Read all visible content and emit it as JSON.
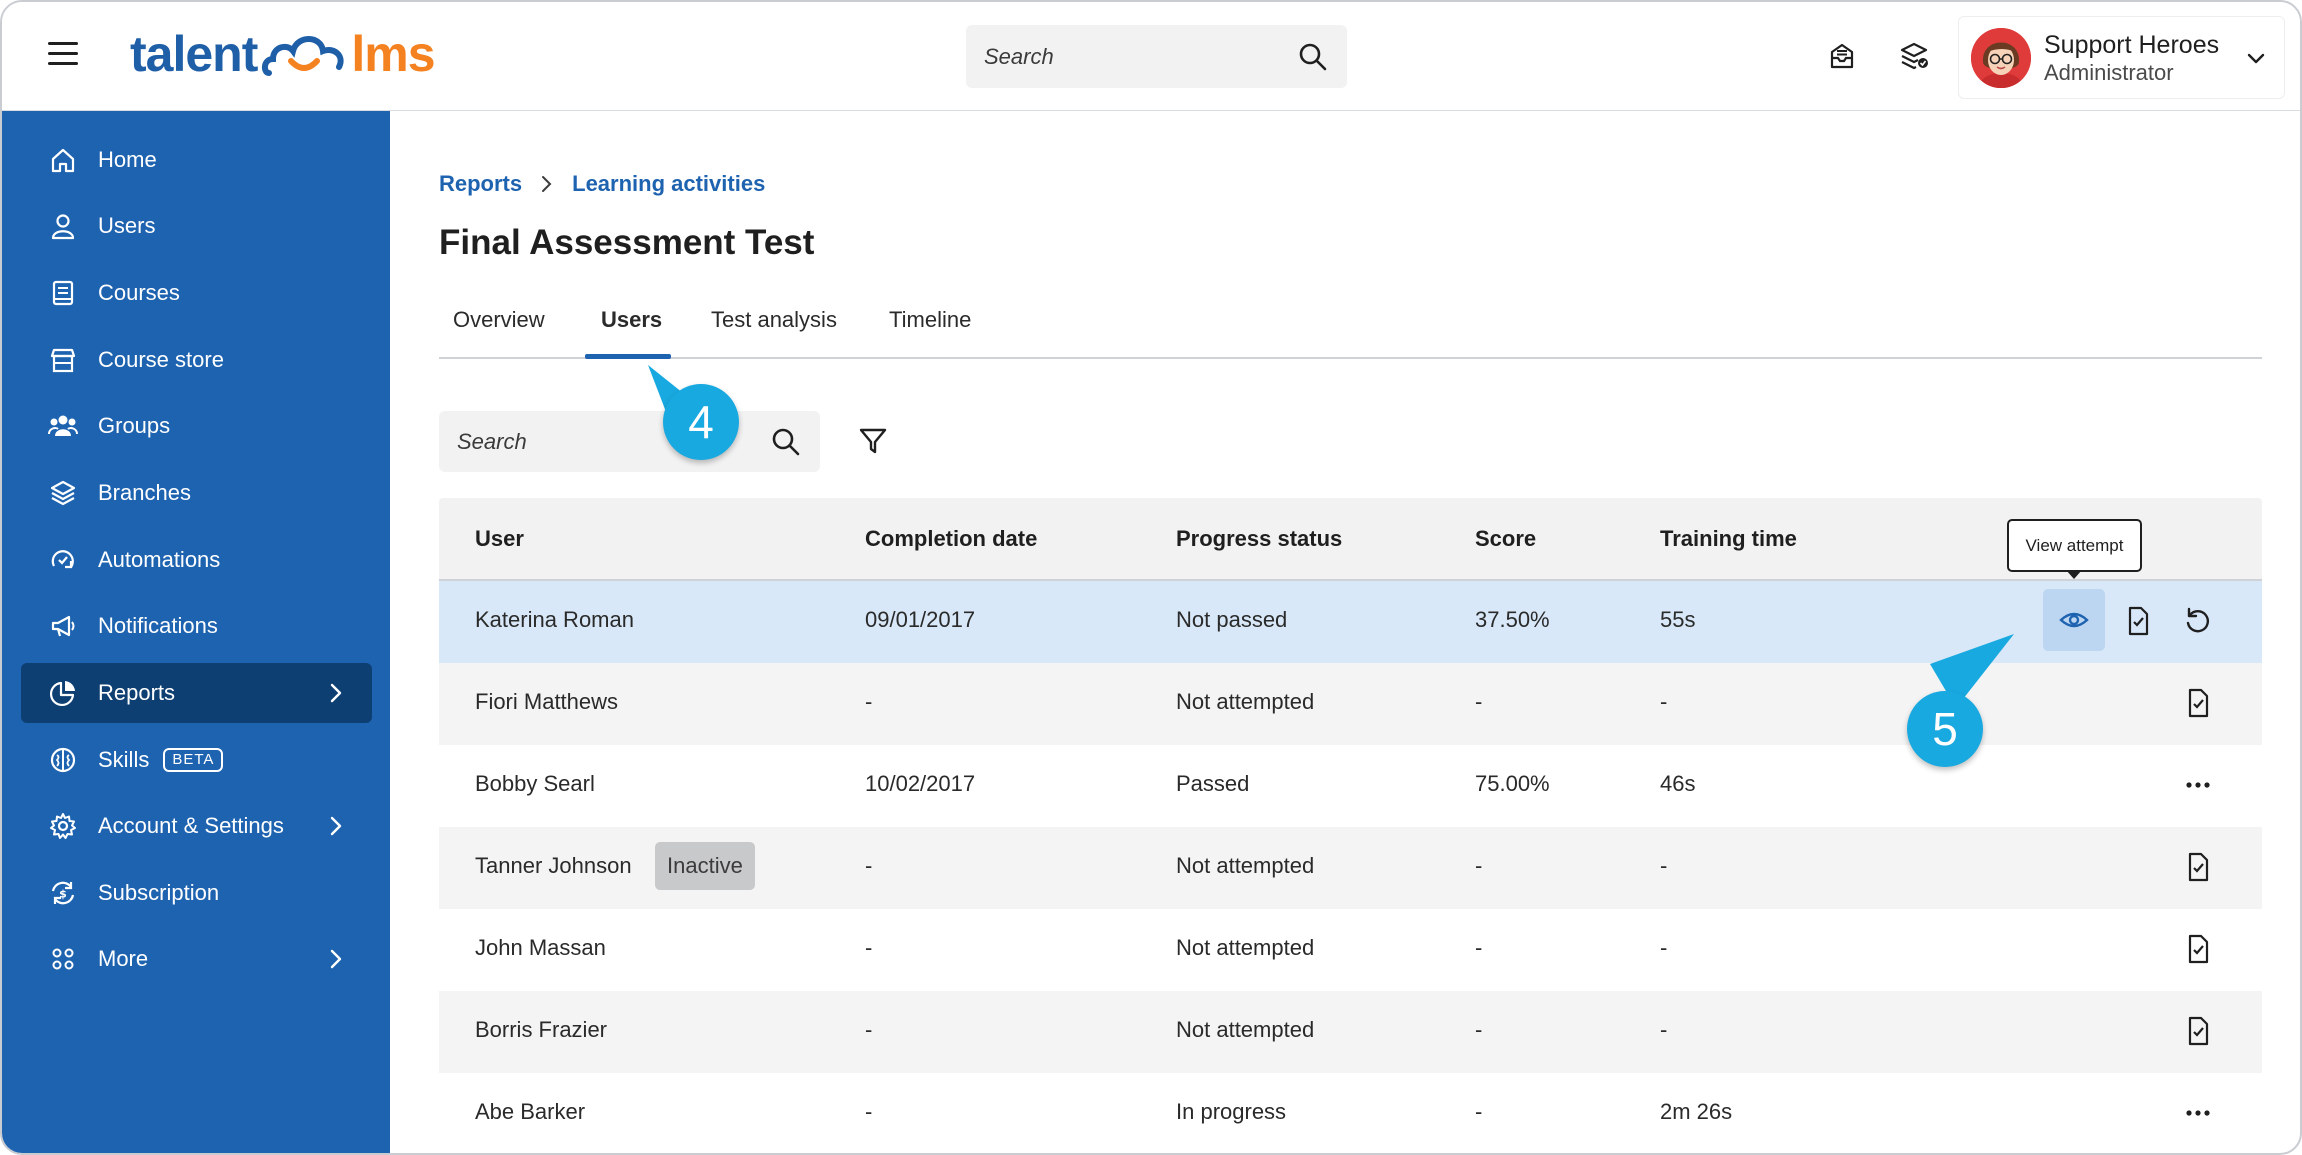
{
  "header": {
    "logo_left": "talent",
    "logo_right": "lms",
    "search_placeholder": "Search",
    "user_name": "Support Heroes",
    "user_role": "Administrator"
  },
  "sidebar": {
    "items": [
      {
        "label": "Home",
        "icon": "home-icon"
      },
      {
        "label": "Users",
        "icon": "user-icon"
      },
      {
        "label": "Courses",
        "icon": "book-icon"
      },
      {
        "label": "Course store",
        "icon": "store-icon"
      },
      {
        "label": "Groups",
        "icon": "groups-icon"
      },
      {
        "label": "Branches",
        "icon": "layers-icon"
      },
      {
        "label": "Automations",
        "icon": "automation-icon"
      },
      {
        "label": "Notifications",
        "icon": "megaphone-icon"
      },
      {
        "label": "Reports",
        "icon": "pie-chart-icon",
        "active": true
      },
      {
        "label": "Skills",
        "icon": "brain-icon",
        "badge": "BETA"
      },
      {
        "label": "Account & Settings",
        "icon": "gear-icon"
      },
      {
        "label": "Subscription",
        "icon": "refresh-dollar-icon"
      },
      {
        "label": "More",
        "icon": "grid-icon"
      }
    ]
  },
  "breadcrumb": {
    "level1": "Reports",
    "level2": "Learning activities"
  },
  "page_title": "Final Assessment Test",
  "tabs": [
    "Overview",
    "Users",
    "Test analysis",
    "Timeline"
  ],
  "active_tab": "Users",
  "table_search_placeholder": "Search",
  "callouts": {
    "first": "4",
    "second": "5"
  },
  "tooltip": "View attempt",
  "table": {
    "columns": [
      "User",
      "Completion date",
      "Progress status",
      "Score",
      "Training time"
    ],
    "rows": [
      {
        "user": "Katerina Roman",
        "date": "09/01/2017",
        "status": "Not passed",
        "score": "37.50%",
        "time": "55s"
      },
      {
        "user": "Fiori Matthews",
        "date": "-",
        "status": "Not attempted",
        "score": "-",
        "time": "-"
      },
      {
        "user": "Bobby Searl",
        "date": "10/02/2017",
        "status": "Passed",
        "score": "75.00%",
        "time": "46s"
      },
      {
        "user": "Tanner Johnson",
        "badge": "Inactive",
        "date": "-",
        "status": "Not attempted",
        "score": "-",
        "time": "-"
      },
      {
        "user": "John Massan",
        "date": "-",
        "status": "Not attempted",
        "score": "-",
        "time": "-"
      },
      {
        "user": "Borris Frazier",
        "date": "-",
        "status": "Not attempted",
        "score": "-",
        "time": "-"
      },
      {
        "user": "Abe Barker",
        "date": "-",
        "status": "In progress",
        "score": "-",
        "time": "2m 26s"
      }
    ]
  },
  "colors": {
    "sidebar": "#1e63b0",
    "sidebar_active": "#0e3f73",
    "accent": "#1e63b0",
    "logo_orange": "#f58220",
    "callout": "#19a9e1",
    "row_highlight": "#d8e8f8"
  }
}
